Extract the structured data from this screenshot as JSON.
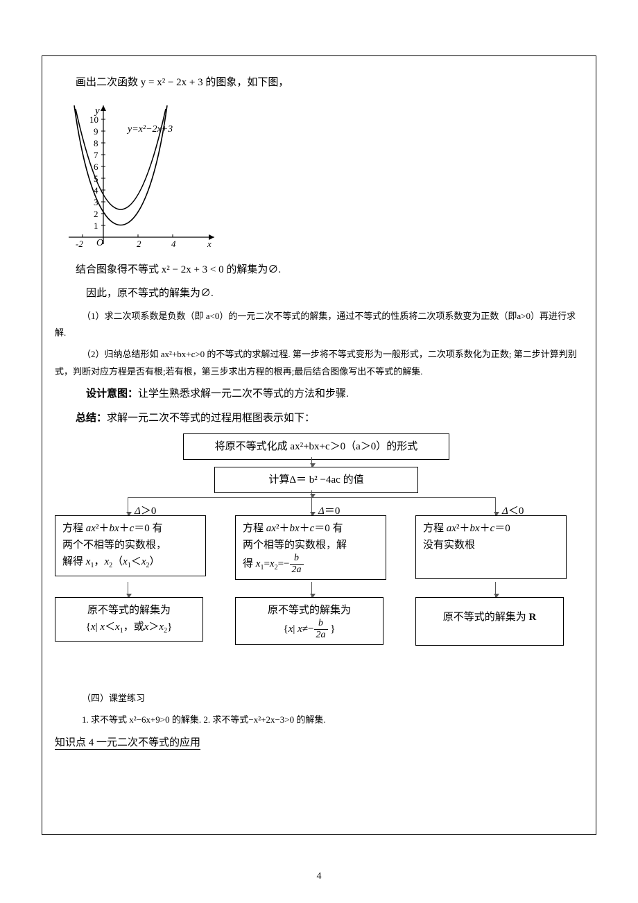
{
  "line1": "画出二次函数 y = x² − 2x + 3 的图象，如下图，",
  "graph": {
    "curve_label": "y=x²−2x+3",
    "x_axis": "x",
    "y_axis": "y",
    "origin": "O",
    "x_ticks": [
      "-2",
      "2",
      "4"
    ],
    "y_ticks": [
      "1",
      "2",
      "3",
      "4",
      "5",
      "6",
      "7",
      "8",
      "9",
      "10"
    ]
  },
  "line2": "结合图象得不等式 x² − 2x + 3 < 0 的解集为∅.",
  "line3": "因此，原不等式的解集为∅.",
  "line4": "（1）求二次项系数是负数（即 a<0）的一元二次不等式的解集，通过不等式的性质将二次项系数变为正数（即a>0）再进行求解.",
  "line5": "（2）归纳总结形如 ax²+bx+c>0 的不等式的求解过程. 第一步将不等式变形为一般形式，二次项系数化为正数; 第二步计算判别式，判断对应方程是否有根;若有根，第三步求出方程的根再;最后结合图像写出不等式的解集.",
  "line6_label": "设计意图：",
  "line6_text": "让学生熟悉求解一元二次不等式的方法和步骤.",
  "line7_label": "总结：",
  "line7_text": "求解一元二次不等式的过程用框图表示如下：",
  "flow": {
    "step1": "将原不等式化成  ax²+bx+c＞0（a＞0）的形式",
    "step2": "计算Δ＝ b² −4ac 的值",
    "cond_left": "Δ＞0",
    "cond_mid": "Δ＝0",
    "cond_right": "Δ＜0",
    "branch_left_a": "方程 ax²＋bx＋c＝0 有两个不相等的实数根，解得 x₁，x₂（x₁＜x₂）",
    "branch_mid_a_pre": "方程 ax²＋bx＋c＝0 有两个相等的实数根，解得 x₁=x₂=−",
    "branch_right_a": "方程 ax²＋bx＋c＝0 没有实数根",
    "branch_left_b": "原不等式的解集为 {x| x＜x₁，或x＞x₂}",
    "branch_mid_b_pre": "原不等式的解集为 {x| x≠−",
    "branch_mid_b_post": " }",
    "branch_right_b": "原不等式的解集为 R",
    "frac_num": "b",
    "frac_den": "2a"
  },
  "section4": "（四）课堂练习",
  "ex1": "1. 求不等式 x²−6x+9>0 的解集. 2. 求不等式−x²+2x−3>0 的解集.",
  "kp4": "知识点 4 一元二次不等式的应用",
  "page_number": "4",
  "chart_data": {
    "type": "line",
    "title": "y = x² − 2x + 3",
    "xlabel": "x",
    "ylabel": "y",
    "xlim": [
      -2.5,
      5
    ],
    "ylim": [
      0,
      10.5
    ],
    "x_ticks": [
      -2,
      0,
      2,
      4
    ],
    "y_ticks": [
      1,
      2,
      3,
      4,
      5,
      6,
      7,
      8,
      9,
      10
    ],
    "series": [
      {
        "name": "y=x²−2x+3",
        "x": [
          -2,
          -1,
          0,
          1,
          2,
          3,
          4
        ],
        "y": [
          11,
          6,
          3,
          2,
          3,
          6,
          11
        ]
      }
    ]
  }
}
